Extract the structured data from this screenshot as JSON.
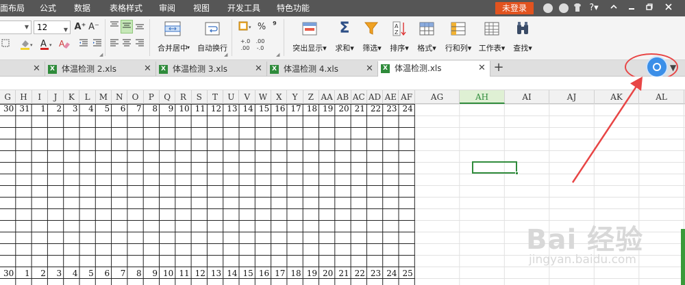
{
  "menu": {
    "items": [
      "面布局",
      "公式",
      "数据",
      "表格样式",
      "审阅",
      "视图",
      "开发工具",
      "特色功能"
    ],
    "login": "未登录",
    "icons": [
      "skin-icon",
      "feedback-icon",
      "shirt-icon",
      "help-icon",
      "collapse-ribbon-icon",
      "minimize-icon",
      "restore-icon",
      "close-icon"
    ]
  },
  "ribbon": {
    "font_size": "12",
    "font_grow": "A⁺",
    "font_shrink": "A⁻",
    "merge_center": "合并居中",
    "wrap_text": "自动换行",
    "percent": "%",
    "thousands": "⁹",
    "dec_inc": ".00",
    "dec_dec": ".00",
    "dec_inc_small": "+.0",
    "dec_dec_small": "-.0",
    "highlight": "突出显示",
    "sum": "求和",
    "filter": "筛选",
    "sort": "排序",
    "format": "格式",
    "rows_cols": "行和列",
    "worksheet": "工作表",
    "find": "查找"
  },
  "tabs": [
    {
      "label": "体温检测 2.xls",
      "active": false
    },
    {
      "label": "体温检测 3.xls",
      "active": false
    },
    {
      "label": "体温检测 4.xls",
      "active": false
    },
    {
      "label": "体温检测.xls",
      "active": true
    }
  ],
  "tab_plus": "+",
  "columns": [
    "G",
    "H",
    "I",
    "J",
    "K",
    "L",
    "M",
    "N",
    "O",
    "P",
    "Q",
    "R",
    "S",
    "T",
    "U",
    "V",
    "W",
    "X",
    "Y",
    "Z",
    "AA",
    "AB",
    "AC",
    "AD",
    "AE",
    "AF",
    "AG",
    "AH",
    "AI",
    "AJ",
    "AK",
    "AL"
  ],
  "selected_column": "AH",
  "row_top_values": [
    "30",
    "31",
    "1",
    "2",
    "3",
    "4",
    "5",
    "6",
    "7",
    "8",
    "9",
    "10",
    "11",
    "12",
    "13",
    "14",
    "15",
    "16",
    "17",
    "18",
    "19",
    "20",
    "21",
    "22",
    "23",
    "24"
  ],
  "row_bottom_values": [
    "30",
    "1",
    "2",
    "3",
    "4",
    "5",
    "6",
    "7",
    "8",
    "9",
    "10",
    "11",
    "12",
    "13",
    "14",
    "15",
    "16",
    "17",
    "18",
    "19",
    "20",
    "21",
    "22",
    "23",
    "24",
    "25"
  ],
  "watermark": {
    "main": "Bai 经验",
    "sub": "jingyan.baidu.com"
  },
  "colors": {
    "accent": "#2f8b3b",
    "login": "#e2531f",
    "annotation": "#e84545",
    "blue": "#3b8fe8"
  }
}
